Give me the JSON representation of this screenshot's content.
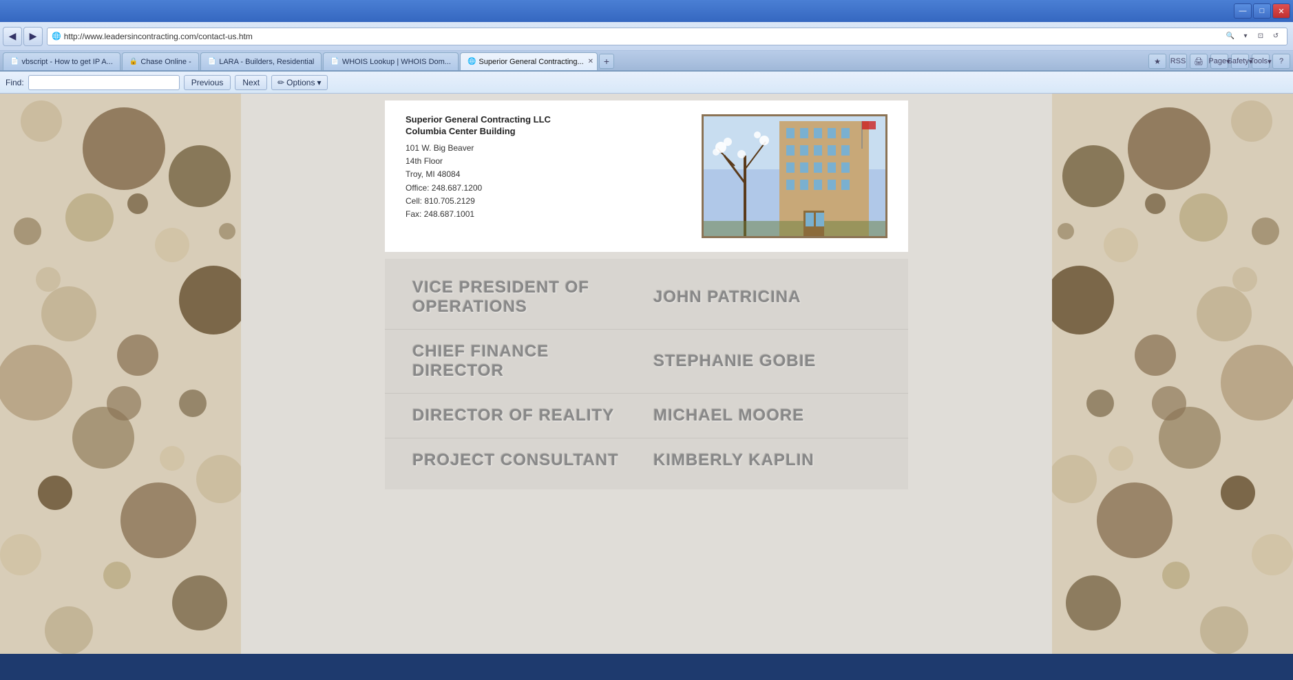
{
  "browser": {
    "title": "Superior General Contracting...",
    "window_controls": {
      "minimize": "—",
      "maximize": "□",
      "close": "✕"
    }
  },
  "nav": {
    "back_label": "◀",
    "forward_label": "▶",
    "address": "http://www.leadersincontracting.com/contact-us.htm",
    "refresh_label": "↻",
    "search_icon": "🔍",
    "compatibility_icon": "⊡",
    "refresh_icon": "↺",
    "stop_icon": "✕"
  },
  "tabs": [
    {
      "id": "tab1",
      "label": "vbscript - How to get IP A...",
      "icon": "📄",
      "active": false,
      "closeable": false
    },
    {
      "id": "tab2",
      "label": "Chase Online -",
      "icon": "🔒",
      "active": false,
      "closeable": false
    },
    {
      "id": "tab3",
      "label": "LARA - Builders, Residential",
      "icon": "📄",
      "active": false,
      "closeable": false
    },
    {
      "id": "tab4",
      "label": "WHOIS Lookup | WHOIS Dom...",
      "icon": "📄",
      "active": false,
      "closeable": false
    },
    {
      "id": "tab5",
      "label": "Superior General Contracting...",
      "icon": "🌐",
      "active": true,
      "closeable": true
    }
  ],
  "toolbar": {
    "page_label": "Page",
    "safety_label": "Safety",
    "tools_label": "Tools",
    "help_icon": "?"
  },
  "find_bar": {
    "find_label": "Find:",
    "input_value": "",
    "previous_label": "Previous",
    "next_label": "Next",
    "options_label": "Options",
    "edit_icon": "✏"
  },
  "contact": {
    "company_name": "Superior General Contracting LLC",
    "building_name": "Columbia Center Building",
    "address_line1": "101 W. Big Beaver",
    "address_line2": "14th Floor",
    "city_state_zip": "Troy, MI 48084",
    "office": "Office: 248.687.1200",
    "cell": "Cell: 810.705.2129",
    "fax": "Fax: 248.687.1001"
  },
  "staff": [
    {
      "title": "VICE PRESIDENT OF OPERATIONS",
      "name": "JOHN PATRICINA"
    },
    {
      "title": "CHIEF FINANCE DIRECTOR",
      "name": "STEPHANIE GOBIE"
    },
    {
      "title": "DIRECTOR OF REALITY",
      "name": "MICHAEL MOORE"
    },
    {
      "title": "PROJECT CONSULTANT",
      "name": "KIMBERLY KAPLIN"
    }
  ]
}
